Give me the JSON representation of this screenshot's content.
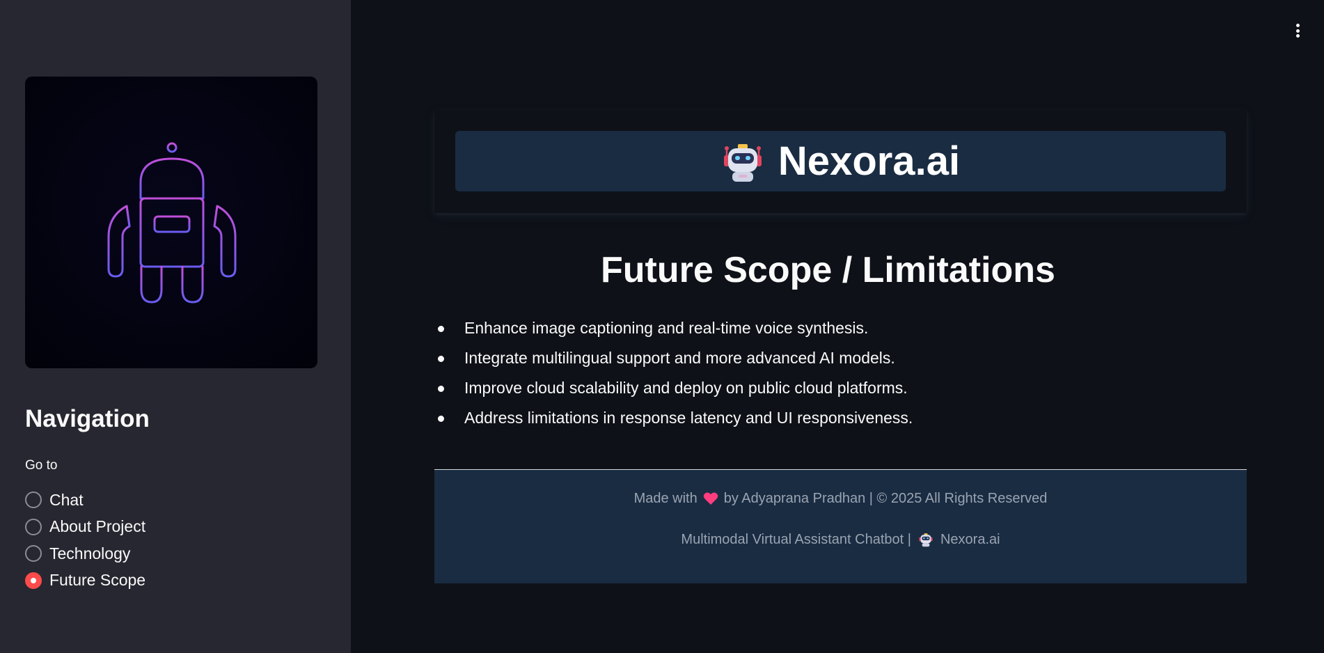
{
  "sidebar": {
    "robot_image": "robot-outline-illustration",
    "nav_title": "Navigation",
    "goto_label": "Go to",
    "options": [
      {
        "label": "Chat",
        "selected": false
      },
      {
        "label": "About Project",
        "selected": false
      },
      {
        "label": "Technology",
        "selected": false
      },
      {
        "label": "Future Scope",
        "selected": true
      }
    ]
  },
  "header": {
    "logo_icon": "robot-emoji-icon",
    "title": "Nexora.ai"
  },
  "main": {
    "section_title": "Future Scope / Limitations",
    "bullets": [
      "Enhance image captioning and real-time voice synthesis.",
      "Integrate multilingual support and more advanced AI models.",
      "Improve cloud scalability and deploy on public cloud platforms.",
      "Address limitations in response latency and UI responsiveness."
    ]
  },
  "footer": {
    "line1_prefix": "Made with",
    "line1_suffix": "by Adyaprana Pradhan | © 2025 All Rights Reserved",
    "line2_prefix": "Multimodal Virtual Assistant Chatbot |",
    "line2_suffix": "Nexora.ai"
  },
  "colors": {
    "background": "#0e1117",
    "sidebar": "#262730",
    "banner": "#1a2c42",
    "accent_radio": "#ff4b4b",
    "heart": "#ff3d7f"
  }
}
